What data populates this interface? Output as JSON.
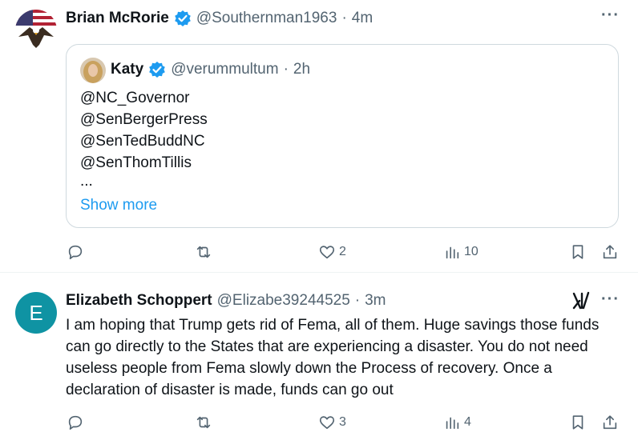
{
  "post1": {
    "author_name": "Brian McRorie",
    "handle": "@Southernman1963",
    "sep": "·",
    "time": "4m",
    "more": "···",
    "quote": {
      "author_name": "Katy",
      "handle": "@verummultum",
      "sep": "·",
      "time": "2h",
      "lines": [
        "@NC_Governor",
        "@SenBergerPress",
        "@SenTedBuddNC",
        "@SenThomTillis",
        "..."
      ],
      "show_more": "Show more"
    },
    "actions": {
      "replies": "",
      "reposts": "",
      "likes": "2",
      "views": "10"
    }
  },
  "post2": {
    "avatar_letter": "E",
    "author_name": "Elizabeth Schoppert",
    "handle": "@Elizabe39244525",
    "sep": "·",
    "time": "3m",
    "more": "···",
    "text": "I am hoping that Trump gets rid of Fema, all of them.  Huge savings those funds can go directly to the States that are experiencing a disaster.  You do not need useless people from Fema slowly down the Process of recovery. Once a declaration of disaster is made, funds can go out",
    "actions": {
      "replies": "",
      "reposts": "",
      "likes": "3",
      "views": "4"
    }
  },
  "colors": {
    "accent": "#1d9bf0",
    "muted": "#536471",
    "avatar_e": "#0f93a3"
  }
}
